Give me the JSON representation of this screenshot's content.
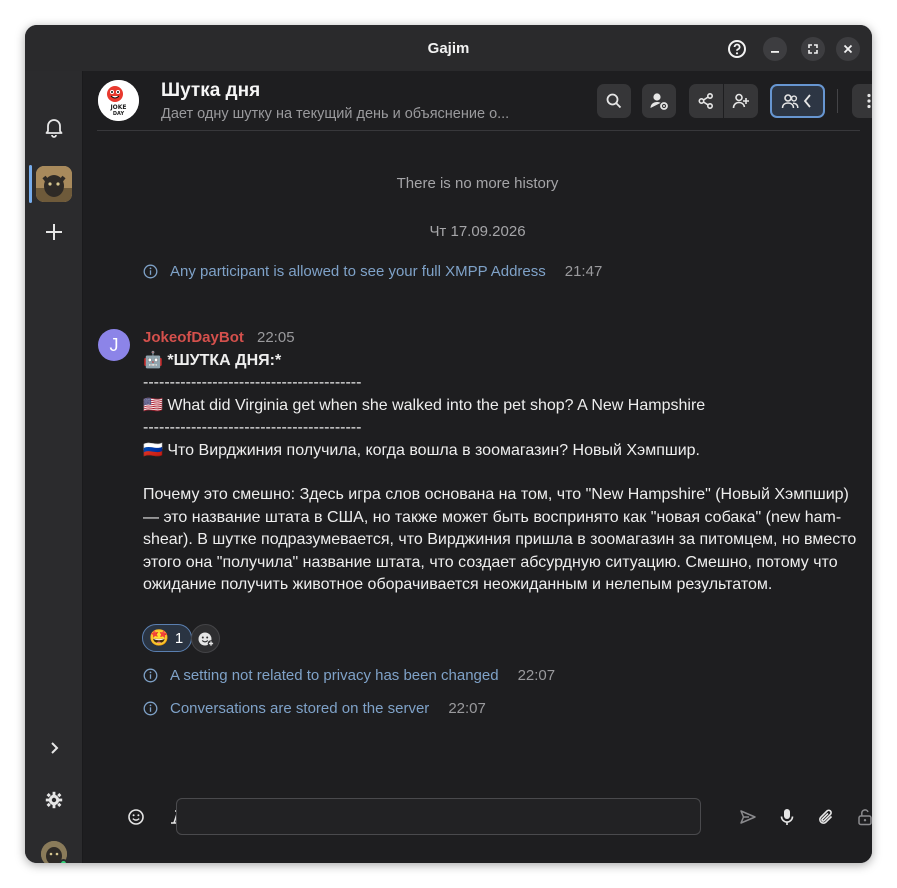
{
  "window": {
    "title": "Gajim"
  },
  "chat": {
    "title": "Шутка дня",
    "description": "Дает одну шутку на текущий день и объяснение о...",
    "avatar_text_top": "JOKE",
    "avatar_text_bottom": "DAY"
  },
  "history": {
    "no_more": "There is no more history",
    "date": "Чт 17.09.2026"
  },
  "info_messages": [
    {
      "text": "Any participant is allowed to see your full XMPP Address",
      "time": "21:47"
    },
    {
      "text": "A setting not related to privacy has been changed",
      "time": "22:07"
    },
    {
      "text": "Conversations are stored on the server",
      "time": "22:07"
    }
  ],
  "message": {
    "avatar_letter": "J",
    "author": "JokeofDayBot",
    "time": "22:05",
    "lines": [
      "🤖 *ШУТКА ДНЯ:*",
      "-----------------------------------------",
      "🇺🇸 What did Virginia get when she walked into the pet shop? A New Hampshire",
      "-----------------------------------------",
      "🇷🇺 Что Вирджиния получила, когда вошла в зоомагазин? Новый Хэмпшир.",
      "",
      "Почему это смешно: Здесь игра слов основана на том, что \"New Hampshire\" (Новый Хэмпшир) — это название штата в США, но также может быть воспринято как \"новая собака\" (new ham-shear). В шутке подразумевается, что Вирджиния пришла в зоомагазин за питомцем, но вместо этого она \"получила\" название штата, что создает абсурдную ситуацию. Смешно, потому что ожидание получить животное оборачивается неожиданным и нелепым результатом."
    ],
    "reaction": {
      "emoji": "🤩",
      "count": "1"
    }
  },
  "composer": {
    "placeholder": ""
  },
  "colors": {
    "accent": "#78aeed",
    "author": "#d4504c",
    "info_text": "#7fa2c8",
    "online": "#33d17a"
  }
}
